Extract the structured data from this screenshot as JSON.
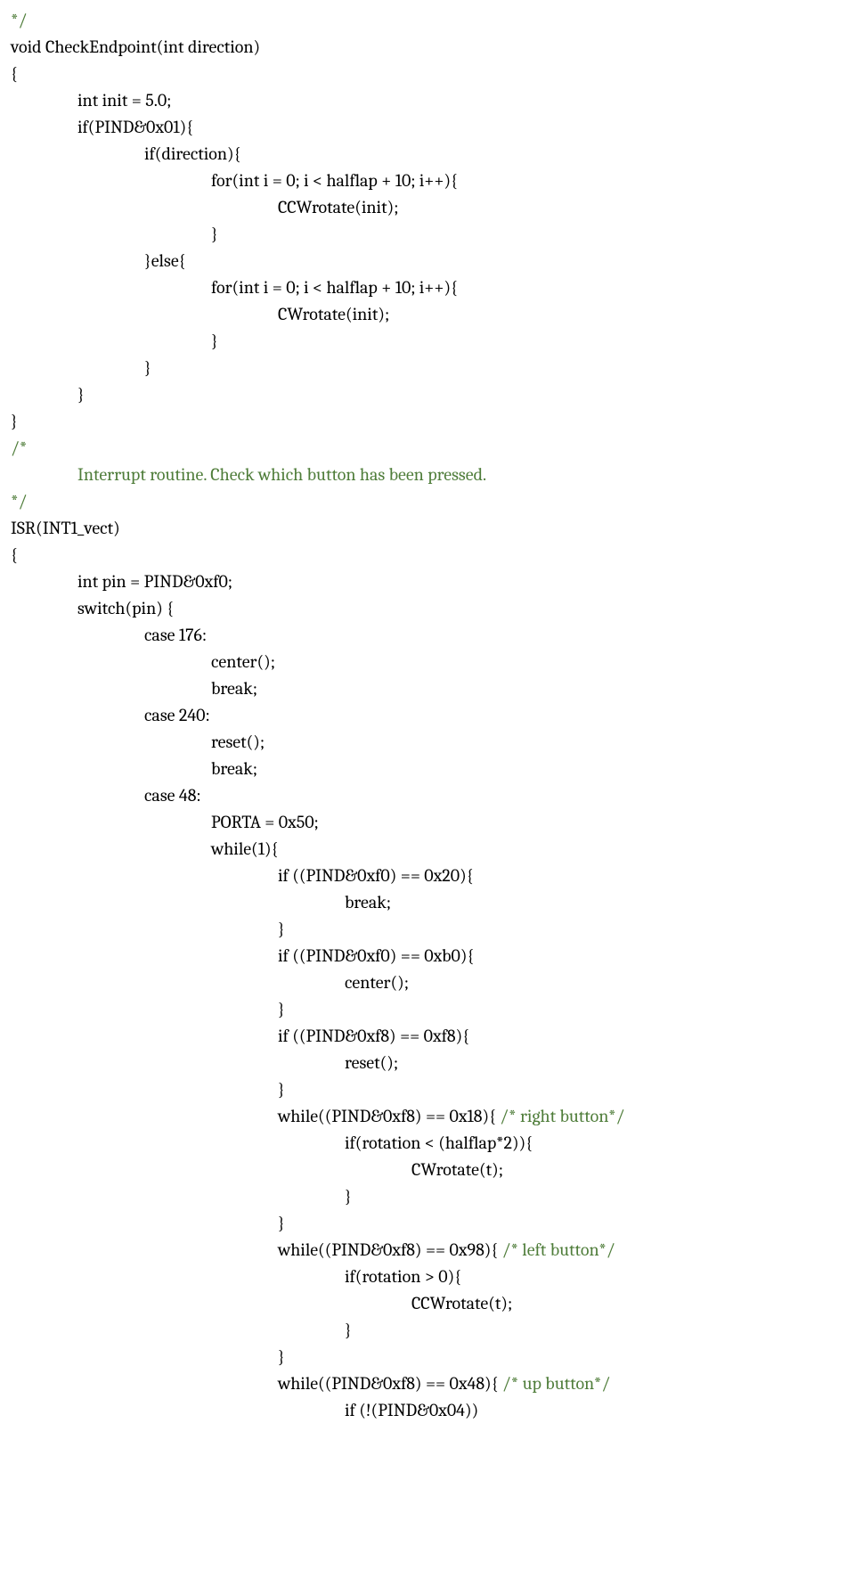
{
  "lines": [
    {
      "text": "*/",
      "indent": 0,
      "comment": true
    },
    {
      "text": "void CheckEndpoint(int direction)",
      "indent": 0
    },
    {
      "text": "{",
      "indent": 0
    },
    {
      "text": "int init = 5.0;",
      "indent": 1
    },
    {
      "text": "if(PIND&0x01){",
      "indent": 1
    },
    {
      "text": "if(direction){",
      "indent": 2
    },
    {
      "text": "for(int i = 0; i < halflap + 10; i++){",
      "indent": 3
    },
    {
      "text": "CCWrotate(init);",
      "indent": 4
    },
    {
      "text": "}",
      "indent": 3
    },
    {
      "text": "}else{",
      "indent": 2
    },
    {
      "text": "for(int i = 0; i < halflap + 10; i++){",
      "indent": 3
    },
    {
      "text": "CWrotate(init);",
      "indent": 4
    },
    {
      "text": "}",
      "indent": 3
    },
    {
      "text": "}",
      "indent": 2
    },
    {
      "text": "}",
      "indent": 1
    },
    {
      "text": "}",
      "indent": 0
    },
    {
      "text": "",
      "indent": 0
    },
    {
      "text": "/*",
      "indent": 0,
      "comment": true
    },
    {
      "text": "Interrupt routine. Check which button has been pressed.",
      "indent": 1,
      "comment": true
    },
    {
      "text": "*/",
      "indent": 0,
      "comment": true
    },
    {
      "text": "ISR(INT1_vect)",
      "indent": 0
    },
    {
      "text": "{",
      "indent": 0
    },
    {
      "text": "int pin = PIND&0xf0;",
      "indent": 1
    },
    {
      "text": "switch(pin) {",
      "indent": 1
    },
    {
      "text": "case 176:",
      "indent": 2
    },
    {
      "text": "center();",
      "indent": 3
    },
    {
      "text": "break;",
      "indent": 3
    },
    {
      "text": "case 240:",
      "indent": 2
    },
    {
      "text": "reset();",
      "indent": 3
    },
    {
      "text": "break;",
      "indent": 3
    },
    {
      "text": "case 48:",
      "indent": 2
    },
    {
      "text": "PORTA = 0x50;",
      "indent": 3
    },
    {
      "text": "while(1){",
      "indent": 3
    },
    {
      "text": "if ((PIND&0xf0) == 0x20){",
      "indent": 4
    },
    {
      "text": "break;",
      "indent": 5
    },
    {
      "text": "}",
      "indent": 4
    },
    {
      "text": "if ((PIND&0xf0) == 0xb0){",
      "indent": 4
    },
    {
      "text": "center();",
      "indent": 5
    },
    {
      "text": "}",
      "indent": 4
    },
    {
      "text": "if ((PIND&0xf8) == 0xf8){",
      "indent": 4
    },
    {
      "text": "reset();",
      "indent": 5
    },
    {
      "text": "}",
      "indent": 4
    },
    {
      "text": "while((PIND&0xf8) == 0x18){ ",
      "indent": 4,
      "trailingComment": "/* right button*/"
    },
    {
      "text": "if(rotation < (halflap*2)){",
      "indent": 5
    },
    {
      "text": "CWrotate(t);",
      "indent": 6
    },
    {
      "text": "}",
      "indent": 5
    },
    {
      "text": "}",
      "indent": 4
    },
    {
      "text": "while((PIND&0xf8) == 0x98){ ",
      "indent": 4,
      "trailingComment": "/* left button*/"
    },
    {
      "text": "if(rotation > 0){",
      "indent": 5
    },
    {
      "text": "CCWrotate(t);",
      "indent": 6
    },
    {
      "text": "}",
      "indent": 5
    },
    {
      "text": "}",
      "indent": 4
    },
    {
      "text": "while((PIND&0xf8) == 0x48){ ",
      "indent": 4,
      "trailingComment": "/* up button*/"
    },
    {
      "text": "if (!(PIND&0x04))",
      "indent": 5
    }
  ]
}
